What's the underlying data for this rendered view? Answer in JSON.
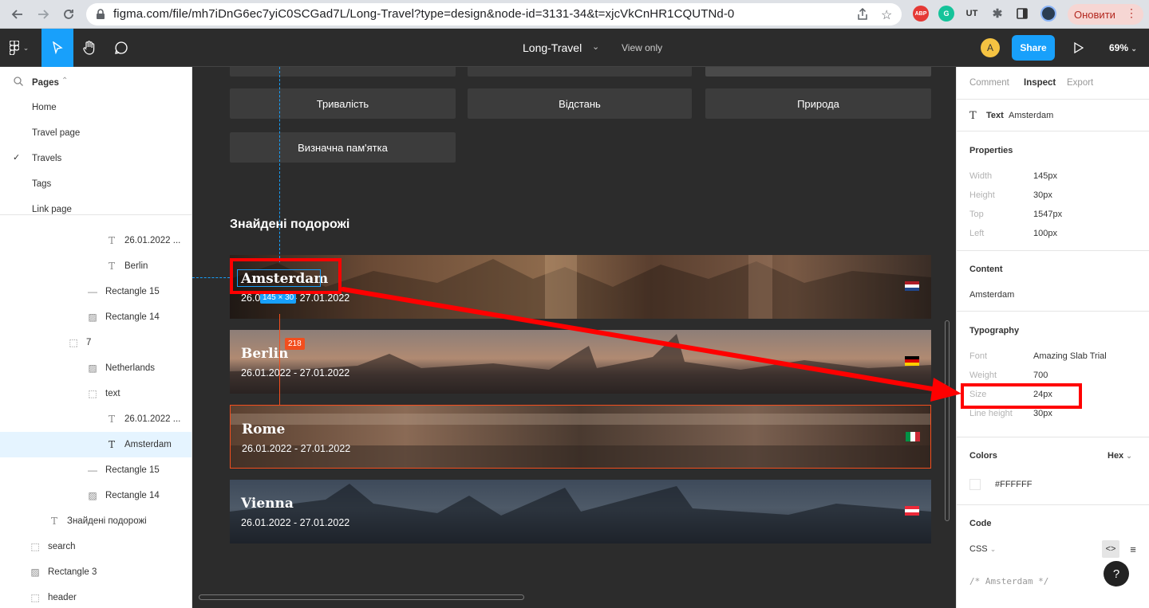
{
  "browser": {
    "url": "figma.com/file/mh7iDnG6ec7yiC0SCGad7L/Long-Travel?type=design&node-id=3131-34&t=xjcVkCnHR1CQUTNd-0",
    "update_label": "Оновити",
    "ext_abp": "ABP",
    "ext_g": "G",
    "ext_ut": "UT"
  },
  "toolbar": {
    "doc_title": "Long-Travel",
    "view_only": "View only",
    "avatar_initial": "A",
    "share_label": "Share",
    "zoom": "69%"
  },
  "pages": {
    "header": "Pages",
    "items": [
      "Home",
      "Travel page",
      "Travels",
      "Tags",
      "Link page"
    ],
    "selected": "Travels"
  },
  "layers": [
    {
      "name": "26.01.2022 ...",
      "icon": "text-icon"
    },
    {
      "name": "Berlin",
      "icon": "text-icon"
    },
    {
      "name": "Rectangle 15",
      "icon": "line-icon"
    },
    {
      "name": "Rectangle 14",
      "icon": "image-icon"
    },
    {
      "name": "7",
      "icon": "frame-icon"
    },
    {
      "name": "Netherlands",
      "icon": "image-icon"
    },
    {
      "name": "text",
      "icon": "frame-icon"
    },
    {
      "name": "26.01.2022 ...",
      "icon": "text-icon"
    },
    {
      "name": "Amsterdam",
      "icon": "text-icon"
    },
    {
      "name": "Rectangle 15",
      "icon": "line-icon"
    },
    {
      "name": "Rectangle 14",
      "icon": "image-icon"
    },
    {
      "name": "Знайдені подорожі",
      "icon": "text-icon"
    },
    {
      "name": "search",
      "icon": "frame-icon"
    },
    {
      "name": "Rectangle 3",
      "icon": "image-icon"
    },
    {
      "name": "header",
      "icon": "frame-icon"
    }
  ],
  "canvas": {
    "filters": [
      "Тривалість",
      "Відстань",
      "Природа",
      "Визначна пам'ятка"
    ],
    "section_title": "Знайдені подорожі",
    "selection_size": "145 × 30",
    "distance_badge": "218",
    "cards": [
      {
        "city": "Amsterdam",
        "date": "26.01.2022 - 27.01.2022",
        "flag": "netherlands"
      },
      {
        "city": "Berlin",
        "date": "26.01.2022 - 27.01.2022",
        "flag": "germany"
      },
      {
        "city": "Rome",
        "date": "26.01.2022 - 27.01.2022",
        "flag": "italy"
      },
      {
        "city": "Vienna",
        "date": "26.01.2022 - 27.01.2022",
        "flag": "austria"
      }
    ]
  },
  "inspect": {
    "tabs": [
      "Comment",
      "Inspect",
      "Export"
    ],
    "active_tab": "Inspect",
    "layer_type": "Text",
    "layer_name": "Amsterdam",
    "properties_title": "Properties",
    "properties": [
      {
        "label": "Width",
        "value": "145px"
      },
      {
        "label": "Height",
        "value": "30px"
      },
      {
        "label": "Top",
        "value": "1547px"
      },
      {
        "label": "Left",
        "value": "100px"
      }
    ],
    "content_title": "Content",
    "content_value": "Amsterdam",
    "typography_title": "Typography",
    "typography": [
      {
        "label": "Font",
        "value": "Amazing Slab Trial"
      },
      {
        "label": "Weight",
        "value": "700"
      },
      {
        "label": "Size",
        "value": "24px"
      },
      {
        "label": "Line height",
        "value": "30px"
      }
    ],
    "colors_title": "Colors",
    "color_format": "Hex",
    "color_value": "#FFFFFF",
    "code_title": "Code",
    "code_lang": "CSS",
    "code_comment": "/* Amsterdam */",
    "help": "?"
  },
  "colors": {
    "accent": "#18a0fb",
    "annotation_red": "#ff0000",
    "selection_orange": "#f24e1e"
  }
}
